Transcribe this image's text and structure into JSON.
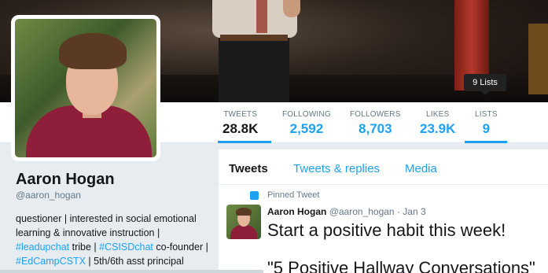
{
  "stats": [
    {
      "label": "TWEETS",
      "value": "28.8K"
    },
    {
      "label": "FOLLOWING",
      "value": "2,592"
    },
    {
      "label": "FOLLOWERS",
      "value": "8,703"
    },
    {
      "label": "LIKES",
      "value": "23.9K"
    },
    {
      "label": "LISTS",
      "value": "9"
    }
  ],
  "tooltip": "9 Lists",
  "profile": {
    "name": "Aaron Hogan",
    "handle": "@aaron_hogan",
    "bio": {
      "part1": "questioner | interested in social emotional learning & innovative instruction |",
      "tag1": "#leadupchat",
      "part2": " tribe | ",
      "tag2": "#CSISDchat",
      "part3": " co-founder | ",
      "tag3": "#EdCampCSTX",
      "part4": " | 5th/6th asst principal"
    }
  },
  "tabs": [
    "Tweets",
    "Tweets & replies",
    "Media"
  ],
  "pinned_label": "Pinned Tweet",
  "tweet": {
    "author": "Aaron Hogan",
    "meta": "@aaron_hogan · Jan 3",
    "text": "Start a positive habit this week!",
    "text2": "\"5 Positive Hallway Conversations\""
  }
}
